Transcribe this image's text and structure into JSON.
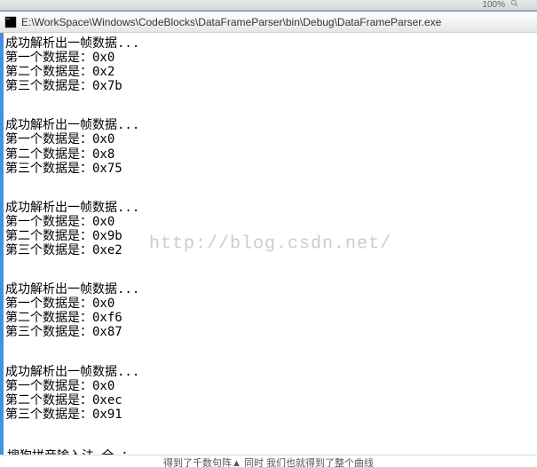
{
  "toolbar": {
    "zoom_label": "100%",
    "search_icon": "search"
  },
  "window": {
    "title": "E:\\WorkSpace\\Windows\\CodeBlocks\\DataFrameParser\\bin\\Debug\\DataFrameParser.exe"
  },
  "console": {
    "frames": [
      {
        "header": "成功解析出一帧数据...",
        "lines": [
          "第一个数据是：0x0",
          "第二个数据是：0x2",
          "第三个数据是：0x7b"
        ]
      },
      {
        "header": "成功解析出一帧数据...",
        "lines": [
          "第一个数据是：0x0",
          "第二个数据是：0x8",
          "第三个数据是：0x75"
        ]
      },
      {
        "header": "成功解析出一帧数据...",
        "lines": [
          "第一个数据是：0x0",
          "第二个数据是：0x9b",
          "第三个数据是：0xe2"
        ]
      },
      {
        "header": "成功解析出一帧数据...",
        "lines": [
          "第一个数据是：0x0",
          "第二个数据是：0xf6",
          "第三个数据是：0x87"
        ]
      },
      {
        "header": "成功解析出一帧数据...",
        "lines": [
          "第一个数据是：0x0",
          "第二个数据是：0xec",
          "第三个数据是：0x91"
        ]
      }
    ],
    "ime_line": "搜狗拼音输入法 全 ："
  },
  "watermark": "http://blog.csdn.net/",
  "status": {
    "text": "得到了千数句阵▲ 同时 我们也就得到了整个曲线"
  }
}
